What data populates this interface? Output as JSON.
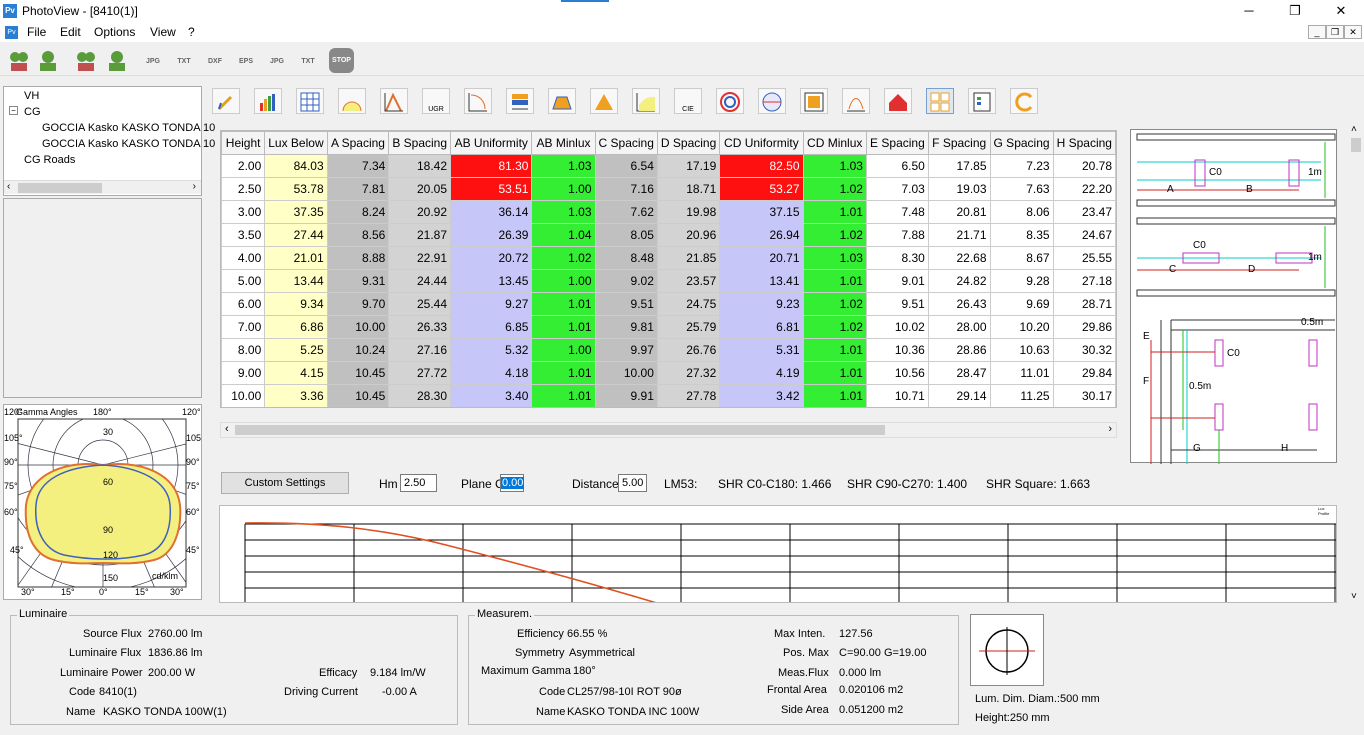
{
  "window": {
    "title": "PhotoView - [8410(1)]",
    "app_icon": "Pv",
    "minimize": "─",
    "maximize": "❐",
    "close": "✕"
  },
  "menu": [
    "File",
    "Edit",
    "Options",
    "View",
    "?"
  ],
  "toolbar1": [
    "",
    "",
    "",
    "",
    "JPG",
    "TXT",
    "DXF",
    "EPS",
    "JPG",
    "TXT",
    "STOP"
  ],
  "tree": {
    "items": [
      "VH",
      "CG",
      "GOCCIA Kasko KASKO TONDA 10",
      "GOCCIA Kasko KASKO TONDA 10",
      "CG Roads"
    ]
  },
  "polar": {
    "top_left": "120°",
    "gamma_label": "Gamma Angles",
    "top_mid": "180°",
    "top_right": "120°",
    "left_labels": [
      "105°",
      "90°",
      "75°",
      "60°",
      "45°"
    ],
    "right_labels": [
      "105°",
      "90°",
      "75°",
      "60°",
      "45°"
    ],
    "radial_labels": [
      "30",
      "60",
      "90",
      "120",
      "150"
    ],
    "unit": "cd/klm",
    "bottom_labels": [
      "30°",
      "15°",
      "0°",
      "15°",
      "30°"
    ]
  },
  "toolbar2": {
    "ugr": "UGR",
    "cie": "CIE"
  },
  "table": {
    "headers": [
      "Height",
      "Lux Below",
      "A Spacing",
      "B Spacing",
      "AB Uniformity",
      "AB Minlux",
      "C Spacing",
      "D Spacing",
      "CD Uniformity",
      "CD Minlux",
      "E Spacing",
      "F Spacing",
      "G Spacing",
      "H Spacing"
    ],
    "rows": [
      [
        "2.00",
        "84.03",
        "7.34",
        "18.42",
        "81.30",
        "1.03",
        "6.54",
        "17.19",
        "82.50",
        "1.03",
        "6.50",
        "17.85",
        "7.23",
        "20.78"
      ],
      [
        "2.50",
        "53.78",
        "7.81",
        "20.05",
        "53.51",
        "1.00",
        "7.16",
        "18.71",
        "53.27",
        "1.02",
        "7.03",
        "19.03",
        "7.63",
        "22.20"
      ],
      [
        "3.00",
        "37.35",
        "8.24",
        "20.92",
        "36.14",
        "1.03",
        "7.62",
        "19.98",
        "37.15",
        "1.01",
        "7.48",
        "20.81",
        "8.06",
        "23.47"
      ],
      [
        "3.50",
        "27.44",
        "8.56",
        "21.87",
        "26.39",
        "1.04",
        "8.05",
        "20.96",
        "26.94",
        "1.02",
        "7.88",
        "21.71",
        "8.35",
        "24.67"
      ],
      [
        "4.00",
        "21.01",
        "8.88",
        "22.91",
        "20.72",
        "1.02",
        "8.48",
        "21.85",
        "20.71",
        "1.03",
        "8.30",
        "22.68",
        "8.67",
        "25.55"
      ],
      [
        "5.00",
        "13.44",
        "9.31",
        "24.44",
        "13.45",
        "1.00",
        "9.02",
        "23.57",
        "13.41",
        "1.01",
        "9.01",
        "24.82",
        "9.28",
        "27.18"
      ],
      [
        "6.00",
        "9.34",
        "9.70",
        "25.44",
        "9.27",
        "1.01",
        "9.51",
        "24.75",
        "9.23",
        "1.02",
        "9.51",
        "26.43",
        "9.69",
        "28.71"
      ],
      [
        "7.00",
        "6.86",
        "10.00",
        "26.33",
        "6.85",
        "1.01",
        "9.81",
        "25.79",
        "6.81",
        "1.02",
        "10.02",
        "28.00",
        "10.20",
        "29.86"
      ],
      [
        "8.00",
        "5.25",
        "10.24",
        "27.16",
        "5.32",
        "1.00",
        "9.97",
        "26.76",
        "5.31",
        "1.01",
        "10.36",
        "28.86",
        "10.63",
        "30.32"
      ],
      [
        "9.00",
        "4.15",
        "10.45",
        "27.72",
        "4.18",
        "1.01",
        "10.00",
        "27.32",
        "4.19",
        "1.01",
        "10.56",
        "28.47",
        "11.01",
        "29.84"
      ],
      [
        "10.00",
        "3.36",
        "10.45",
        "28.30",
        "3.40",
        "1.01",
        "9.91",
        "27.78",
        "3.42",
        "1.01",
        "10.71",
        "29.14",
        "11.25",
        "30.17"
      ]
    ]
  },
  "diagram": {
    "c0": "C0",
    "a": "A",
    "b": "B",
    "c": "C",
    "d": "D",
    "e": "E",
    "f": "F",
    "g": "G",
    "h": "H",
    "one_m": "1m",
    "half_m": "0.5m"
  },
  "controls": {
    "custom_settings": "Custom Settings",
    "hm_label": "Hm",
    "hm_value": "2.50",
    "planec_label": "Plane C",
    "planec_value": "0.00",
    "distance_label": "Distance",
    "distance_value": "5.00",
    "lm53": "LM53:",
    "shr_c0": "SHR C0-C180:  1.466",
    "shr_c90": "SHR C90-C270:  1.400",
    "shr_sq": "SHR Square:  1.663"
  },
  "profile": {
    "title": "Lux Profile"
  },
  "luminaire": {
    "title": "Luminaire",
    "source_flux_label": "Source Flux",
    "source_flux": "2760.00 lm",
    "lum_flux_label": "Luminaire Flux",
    "lum_flux": "1836.86 lm",
    "power_label": "Luminaire Power",
    "power": "200.00 W",
    "code_label": "Code",
    "code": "8410(1)",
    "name_label": "Name",
    "name": "KASKO TONDA 100W(1)",
    "efficacy_label": "Efficacy",
    "efficacy": "9.184 lm/W",
    "current_label": "Driving Current",
    "current": "-0.00 A"
  },
  "measurem": {
    "title": "Measurem.",
    "efficiency_label": "Efficiency",
    "efficiency": "66.55 %",
    "symmetry_label": "Symmetry",
    "symmetry": "Asymmetrical",
    "maxgamma_label": "Maximum Gamma",
    "maxgamma": "180°",
    "code_label": "Code",
    "code": "CL257/98-10I ROT 90ø",
    "name_label": "Name",
    "name": "KASKO TONDA INC 100W",
    "maxinten_label": "Max Inten.",
    "maxinten": "127.56",
    "posmax_label": "Pos. Max",
    "posmax": "C=90.00 G=19.00",
    "measflux_label": "Meas.Flux",
    "measflux": "0.000 lm",
    "frontal_label": "Frontal Area",
    "frontal": "0.020106 m2",
    "side_label": "Side Area",
    "side": "0.051200 m2"
  },
  "dim": {
    "diam": "Lum. Dim. Diam.:500 mm",
    "height": "Height:250 mm"
  }
}
